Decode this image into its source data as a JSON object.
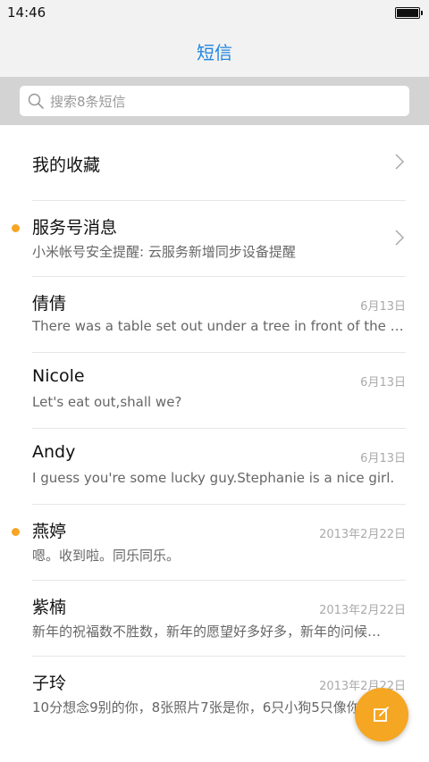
{
  "status_bar": {
    "time": "14:46"
  },
  "header": {
    "title": "短信"
  },
  "search": {
    "placeholder": "搜索8条短信"
  },
  "favorites": {
    "label": "我的收藏"
  },
  "service": {
    "title": "服务号消息",
    "preview": "小米帐号安全提醒: 云服务新增同步设备提醒",
    "unread": true
  },
  "conversations": [
    {
      "name": "倩倩",
      "date": "6月13日",
      "preview": "There was a table set out under a tree in front of the ho…",
      "unread": false
    },
    {
      "name": "Nicole",
      "date": "6月13日",
      "preview": "Let's eat out,shall we?",
      "unread": false
    },
    {
      "name": "Andy",
      "date": "6月13日",
      "preview": "I guess you're some lucky guy.Stephanie is a nice girl.",
      "unread": false
    },
    {
      "name": "燕婷",
      "date": "2013年2月22日",
      "preview": "嗯。收到啦。同乐同乐。",
      "unread": true
    },
    {
      "name": "紫楠",
      "date": "2013年2月22日",
      "preview": "新年的祝福数不胜数，新年的愿望好多好多，新年的问候…",
      "unread": false
    },
    {
      "name": "子玲",
      "date": "2013年2月22日",
      "preview": "10分想念9别的你，8张照片7张是你，6只小狗5只像你",
      "unread": false
    }
  ],
  "colors": {
    "accent": "#2185e0",
    "unread_dot": "#f5a623",
    "fab": "#f5a623"
  },
  "icons": {
    "search": "search-icon",
    "chevron": "chevron-right-icon",
    "compose": "compose-icon"
  }
}
